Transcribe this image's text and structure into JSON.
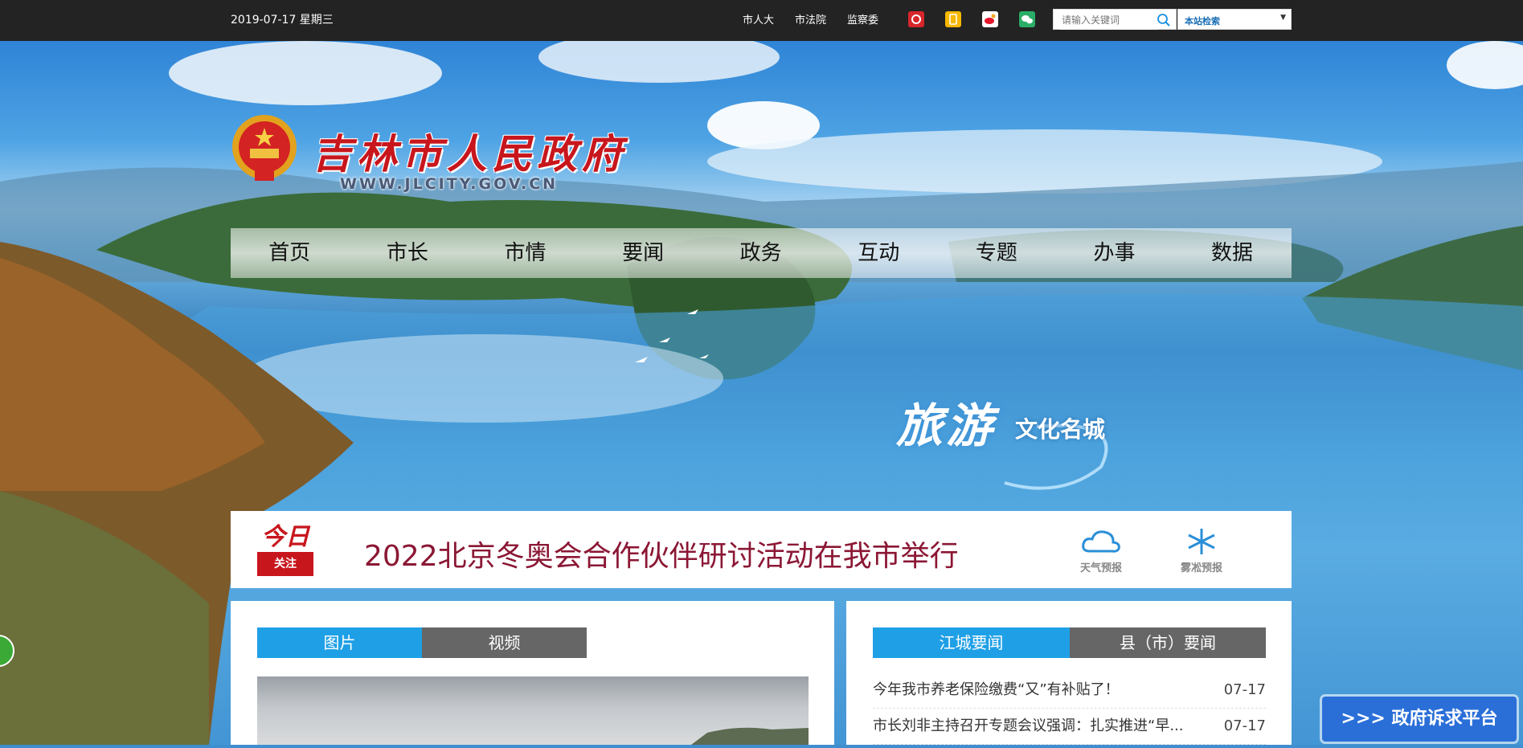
{
  "topbar": {
    "date": "2019-07-17 星期三",
    "links": [
      "市人大",
      "市法院",
      "监察委"
    ],
    "social_icons": [
      {
        "name": "weibo-red-icon",
        "color": "#d7262b"
      },
      {
        "name": "app-icon",
        "color": "#f5b700"
      },
      {
        "name": "weibo-icon",
        "color": "#e6162d"
      },
      {
        "name": "wechat-icon",
        "color": "#2aae67"
      }
    ],
    "search_placeholder": "请输入关键词",
    "search_scope": "本站检索"
  },
  "header": {
    "site_title": "吉林市人民政府",
    "site_url": "WWW.JLCITY.GOV.CN"
  },
  "nav": {
    "items": [
      "首页",
      "市长",
      "市情",
      "要闻",
      "政务",
      "互动",
      "专题",
      "办事",
      "数据"
    ]
  },
  "banner": {
    "slogan_main": "旅游",
    "slogan_sub": "文化名城"
  },
  "focus": {
    "badge_top": "今日",
    "badge_bottom": "关注",
    "headline": "2022北京冬奥会合作伙伴研讨活动在我市举行",
    "weather_label": "天气预报",
    "rime_label": "雾凇预报"
  },
  "media_panel": {
    "tabs": [
      "图片",
      "视频"
    ],
    "active_tab": "图片"
  },
  "news_panel": {
    "tabs": [
      "江城要闻",
      "县（市）要闻"
    ],
    "active_tab": "江城要闻",
    "items": [
      {
        "title": "今年我市养老保险缴费“又”有补贴了！",
        "date": "07-17"
      },
      {
        "title": "市长刘非主持召开专题会议强调：扎实推进“早...",
        "date": "07-17"
      }
    ]
  },
  "float": {
    "appeal_label": ">>> 政府诉求平台"
  },
  "colors": {
    "accent_blue": "#1fa0e6",
    "brand_red": "#c8161d",
    "headline_red": "#8b1734"
  }
}
